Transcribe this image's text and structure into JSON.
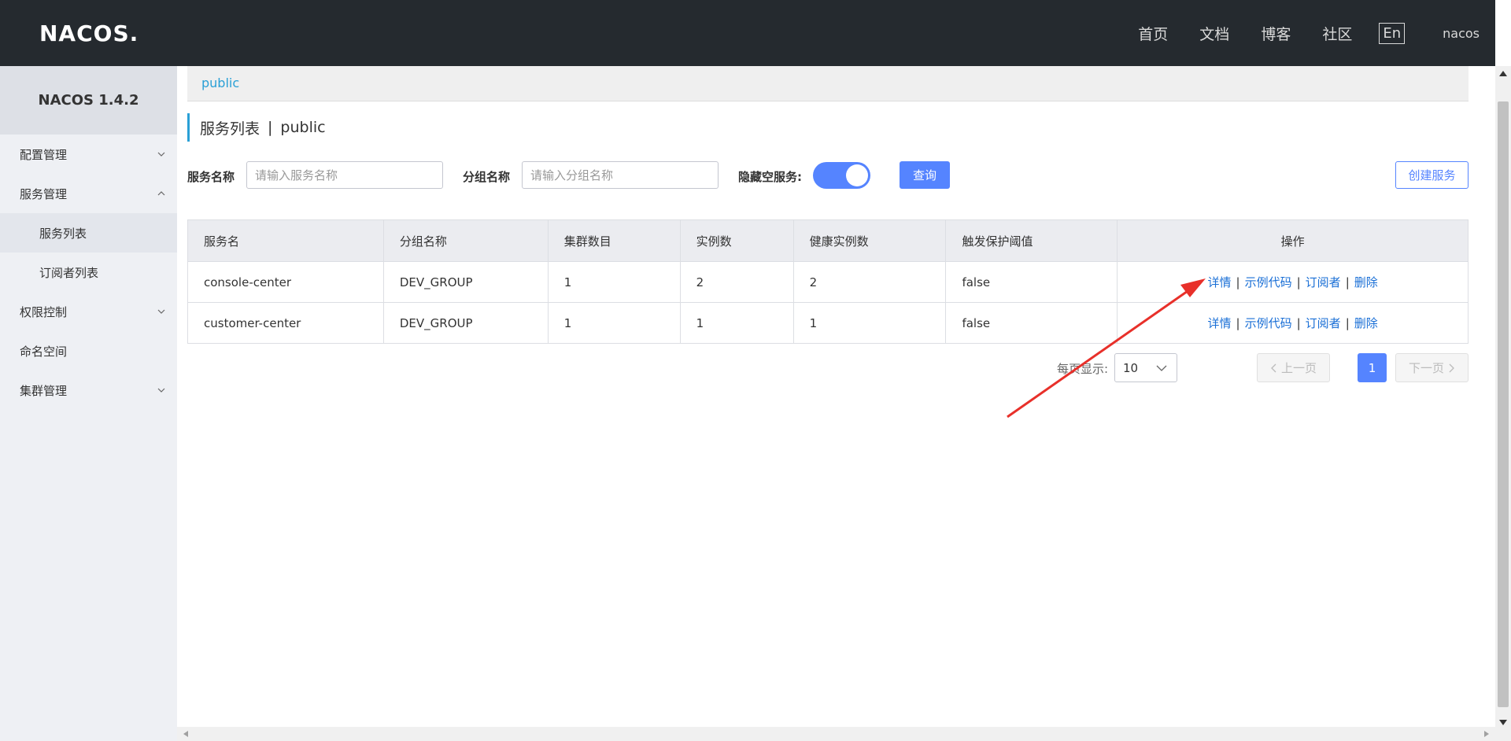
{
  "header": {
    "logo": "NACOS.",
    "nav": [
      "首页",
      "文档",
      "博客",
      "社区"
    ],
    "lang": "En",
    "user": "nacos"
  },
  "sidebar": {
    "version": "NACOS 1.4.2",
    "items": [
      {
        "label": "配置管理",
        "expanded": false
      },
      {
        "label": "服务管理",
        "expanded": true
      },
      {
        "label": "服务列表",
        "sub": true,
        "active": true
      },
      {
        "label": "订阅者列表",
        "sub": true
      },
      {
        "label": "权限控制",
        "expanded": false
      },
      {
        "label": "命名空间"
      },
      {
        "label": "集群管理",
        "expanded": false
      }
    ]
  },
  "namespace": "public",
  "page_title": {
    "title": "服务列表",
    "sep": "|",
    "ns": "public"
  },
  "filters": {
    "service_label": "服务名称",
    "service_placeholder": "请输入服务名称",
    "group_label": "分组名称",
    "group_placeholder": "请输入分组名称",
    "hide_empty_label": "隐藏空服务:",
    "hide_empty_on": true,
    "query_button": "查询",
    "create_button": "创建服务"
  },
  "table": {
    "columns": [
      "服务名",
      "分组名称",
      "集群数目",
      "实例数",
      "健康实例数",
      "触发保护阈值",
      "操作"
    ],
    "rows": [
      [
        "console-center",
        "DEV_GROUP",
        "1",
        "2",
        "2",
        "false"
      ],
      [
        "customer-center",
        "DEV_GROUP",
        "1",
        "1",
        "1",
        "false"
      ]
    ],
    "actions": [
      "详情",
      "示例代码",
      "订阅者",
      "删除"
    ],
    "action_sep": "|"
  },
  "pagination": {
    "page_size_label": "每页显示:",
    "page_size": "10",
    "prev": "上一页",
    "current": "1",
    "next": "下一页"
  },
  "colors": {
    "topbar": "#252a2f",
    "primary": "#5584ff",
    "accent": "#2aa0d6",
    "annotation_arrow": "#e8302a"
  }
}
